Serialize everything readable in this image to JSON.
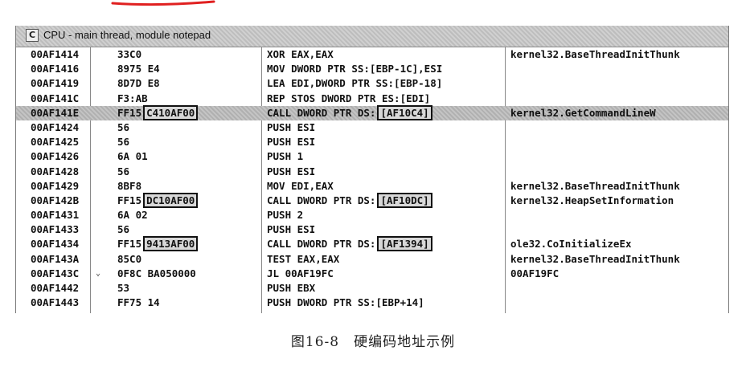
{
  "window": {
    "title": "CPU - main thread, module notepad",
    "icon_letter": "C"
  },
  "rows": [
    {
      "addr": "00AF1414",
      "hex": "33C0",
      "dis": "XOR EAX,EAX",
      "comment": "kernel32.BaseThreadInitThunk"
    },
    {
      "addr": "00AF1416",
      "hex": "8975 E4",
      "dis": "MOV DWORD PTR SS:[EBP-1C],ESI",
      "comment": ""
    },
    {
      "addr": "00AF1419",
      "hex": "8D7D E8",
      "dis": "LEA EDI,DWORD PTR SS:[EBP-18]",
      "comment": ""
    },
    {
      "addr": "00AF141C",
      "hex": "F3:AB",
      "dis": "REP STOS DWORD PTR ES:[EDI]",
      "comment": ""
    },
    {
      "addr": "00AF141E",
      "hex": "FF15 C410AF00",
      "dis": "CALL DWORD PTR DS:[AF10C4]",
      "comment": "kernel32.GetCommandLineW"
    },
    {
      "addr": "00AF1424",
      "hex": "56",
      "dis": "PUSH ESI",
      "comment": ""
    },
    {
      "addr": "00AF1425",
      "hex": "56",
      "dis": "PUSH ESI",
      "comment": ""
    },
    {
      "addr": "00AF1426",
      "hex": "6A 01",
      "dis": "PUSH 1",
      "comment": ""
    },
    {
      "addr": "00AF1428",
      "hex": "56",
      "dis": "PUSH ESI",
      "comment": ""
    },
    {
      "addr": "00AF1429",
      "hex": "8BF8",
      "dis": "MOV EDI,EAX",
      "comment": "kernel32.BaseThreadInitThunk"
    },
    {
      "addr": "00AF142B",
      "hex": "FF15 DC10AF00",
      "dis": "CALL DWORD PTR DS:[AF10DC]",
      "comment": "kernel32.HeapSetInformation"
    },
    {
      "addr": "00AF1431",
      "hex": "6A 02",
      "dis": "PUSH 2",
      "comment": ""
    },
    {
      "addr": "00AF1433",
      "hex": "56",
      "dis": "PUSH ESI",
      "comment": ""
    },
    {
      "addr": "00AF1434",
      "hex": "FF15 9413AF00",
      "dis": "CALL DWORD PTR DS:[AF1394]",
      "comment": "ole32.CoInitializeEx"
    },
    {
      "addr": "00AF143A",
      "hex": "85C0",
      "dis": "TEST EAX,EAX",
      "comment": "kernel32.BaseThreadInitThunk"
    },
    {
      "addr": "00AF143C",
      "hex": "0F8C BA050000",
      "dis": "JL 00AF19FC",
      "comment": "00AF19FC"
    },
    {
      "addr": "00AF1442",
      "hex": "53",
      "dis": "PUSH EBX",
      "comment": ""
    },
    {
      "addr": "00AF1443",
      "hex": "FF75 14",
      "dis": "PUSH DWORD PTR SS:[EBP+14]",
      "comment": ""
    }
  ],
  "jump_arrow": "⌄",
  "caption": "图16-8　硬编码地址示例"
}
